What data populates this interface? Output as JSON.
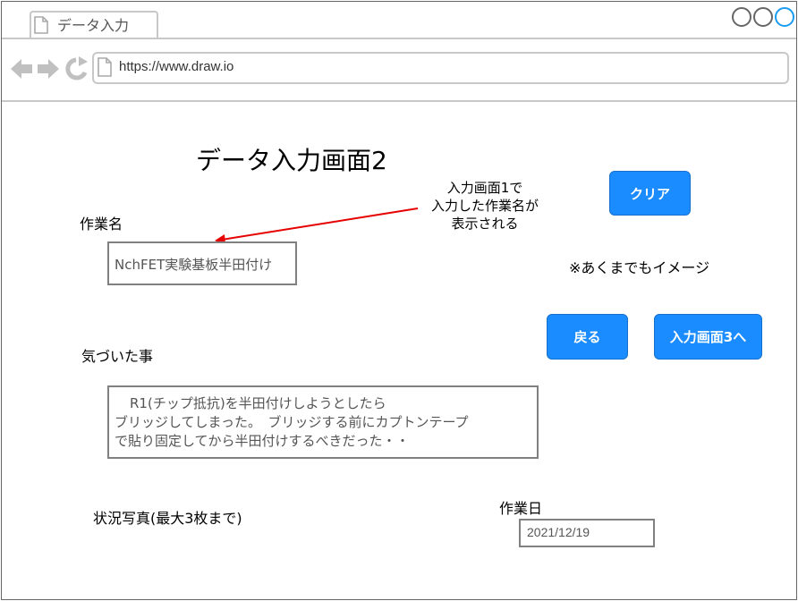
{
  "browser": {
    "tab_title": "データ入力",
    "url": "https://www.draw.io"
  },
  "page": {
    "title": "データ入力画面2",
    "annotation_lines": [
      "入力画面1で",
      "入力した作業名が",
      "表示される"
    ],
    "note": "※あくまでもイメージ"
  },
  "form": {
    "task_name_label": "作業名",
    "task_name_value": "NchFET実験基板半田付け",
    "notice_label": "気づいた事",
    "notice_lines": [
      "R1(チップ抵抗)を半田付けしようとしたら",
      "ブリッジしてしまった。　ブリッジする前にカプトンテープ",
      "で貼り固定してから半田付けするべきだった・・"
    ],
    "photo_label": "状況写真(最大3枚まで)",
    "date_label": "作業日",
    "date_value": "2021/12/19"
  },
  "buttons": {
    "clear": "クリア",
    "back": "戻る",
    "next": "入力画面3へ"
  },
  "colors": {
    "button_blue": "#1a8cff",
    "arrow_red": "#e60000"
  }
}
